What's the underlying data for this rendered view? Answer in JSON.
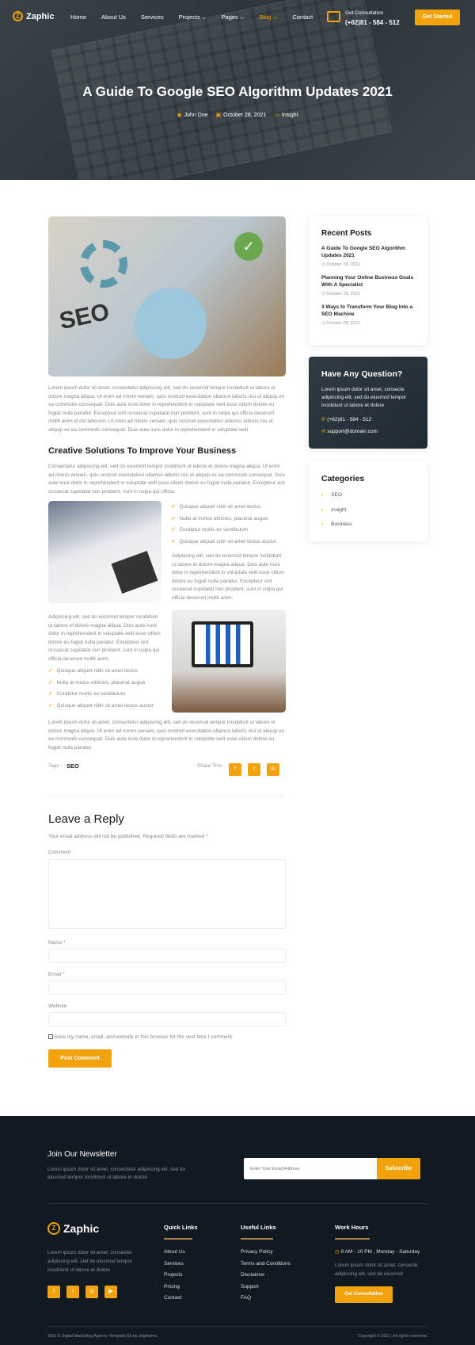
{
  "header": {
    "brand": "Zaphic",
    "nav": [
      {
        "label": "Home"
      },
      {
        "label": "About Us"
      },
      {
        "label": "Services"
      },
      {
        "label": "Projects ⌵"
      },
      {
        "label": "Pages ⌵"
      },
      {
        "label": "Blog ⌵",
        "active": true
      },
      {
        "label": "Contact"
      }
    ],
    "consult_label": "Get Consultation",
    "phone": "(+62)81 - 584 - 512",
    "cta": "Get Started"
  },
  "hero": {
    "title": "A Guide To Google SEO Algorithm Updates 2021",
    "author": "John Doe",
    "date": "October 28, 2021",
    "category": "Insight"
  },
  "article": {
    "para1": "Lorem ipsum dolor sit amet, consectetur adipiscing elit, sed do eiusmod tempor incididunt ut labore et dolore magna aliqua. Ut enim ad minim veniam, quis nostrud exercitation ullamco laboris nisi ut aliquip ex ea commodo consequat. Duis aute irure dolor in reprehenderit in voluptate velit esse cillum dolore eu fugiat nulla pariatur. Excepteur sint occaecat cupidatat non proident, sunt in culpa qui officia deserunt mollit anim id est laborum. Ut enim ad minim veniam, quis nostrud exercitation ullamco laboris nisi ut aliquip ex ea commodo consequat. Duis aute irure dolor in reprehenderit in voluptate velit.",
    "heading": "Creative Solutions To Improve Your Business",
    "para2": "Consectetur adipiscing elit, sed do eiusmod tempor incididunt ut labore et dolore magna aliqua. Ut enim ad minim veniam, quis nostrud exercitation ullamco laboris nisi ut aliquip ex ea commodo consequat. Duis aute irure dolor in reprehenderit in voluptate velit esse cillum dolore eu fugiat nulla pariatur. Excepteur sint occaecat cupidatat non proident, sunt in culpa qui officia.",
    "list": [
      "Quisque aliquet nibh sit amet lectus",
      "Nulla at metus ultricies, placerat augue",
      "Curabitur mollis ex vestibulum",
      "Quisque aliquet nibh sit amet lectus auctor"
    ],
    "para3": "Adipiscing elit, sed do eiusmod tempor incididunt ut labore et dolore magna aliqua. Duis aute irure dolor in reprehenderit in voluptate velit esse cillum dolore eu fugiat nulla pariatur. Excepteur sint occaecat cupidatat non proident, sunt in culpa qui officia deserunt mollit anim.",
    "para4": "Lorem ipsum dolor sit amet, consectetur adipiscing elit, sed do eiusmod tempor incididunt ut labore et dolore magna aliqua. Ut enim ad minim veniam, quis nostrud exercitation ullamco laboris nisi ut aliquip ex ea commodo consequat. Duis aute irure dolor in reprehenderit in voluptate velit esse cillum dolore eu fugiat nulla pariatur.",
    "tags_label": "Tags :",
    "tag": "SEO",
    "share_label": "Share This :",
    "seo_img_text": "SEO"
  },
  "reply": {
    "title": "Leave a Reply",
    "note": "Your email address will not be published. Required fields are marked *",
    "comment": "Comment",
    "name": "Name *",
    "email": "Email *",
    "website": "Website",
    "save": "Save my name, email, and website in this browser for the next time I comment.",
    "submit": "Post Comment"
  },
  "sidebar": {
    "recent_title": "Recent Posts",
    "posts": [
      {
        "title": "A Guide To Google SEO Algorithm Updates 2021",
        "date": "October 28, 2021"
      },
      {
        "title": "Planning Your Online Business Goals With A Specialist",
        "date": "October 28, 2021"
      },
      {
        "title": "3 Ways to Transform Your Blog Into a SEO Machine",
        "date": "October 28, 2021"
      }
    ],
    "question_title": "Have Any Question?",
    "question_text": "Lorem ipsum dolor sit amet, consecte adipiscing elit, sed do eiusmod tempor incididunt ut labore et dolore",
    "phone": "(+62)81 - 584 - 512",
    "email": "support@domain.com",
    "categories_title": "Categories",
    "categories": [
      "SEO",
      "Insight",
      "Business"
    ]
  },
  "footer": {
    "newsletter_title": "Join Our Newsletter",
    "newsletter_text": "Lorem ipsum dolor sit amet, consectetur adipiscing elit, sed do eiusmod tempor incididunt ut labore et dolore",
    "email_placeholder": "Enter Your Email Address",
    "subscribe": "Subscribe",
    "brand": "Zaphic",
    "about": "Lorem ipsum dolor sit amet, consectet adipiscing elit, sed do eiusmod tempor incididunt ut labore et dolore",
    "quick_title": "Quick Links",
    "quick": [
      "About Us",
      "Services",
      "Projects",
      "Pricing",
      "Contact"
    ],
    "useful_title": "Useful Links",
    "useful": [
      "Privacy Policy",
      "Terms and Conditions",
      "Disclaimer",
      "Support",
      "FAQ"
    ],
    "hours_title": "Work Hours",
    "hours": "9 AM - 10 PM , Monday - Saturday",
    "hours_text": "Lorem ipsum dolor sit amet, consecte adipiscing elit, sed do eiusmod",
    "hours_cta": "Get Consultation",
    "credit": "SEO & Digital Marketing Agency Template Kit by Jegtheme",
    "copyright": "Copyright © 2021. All rights reserved."
  },
  "colors": {
    "accent": "#f2a20c",
    "footer_bg": "#111a21"
  }
}
